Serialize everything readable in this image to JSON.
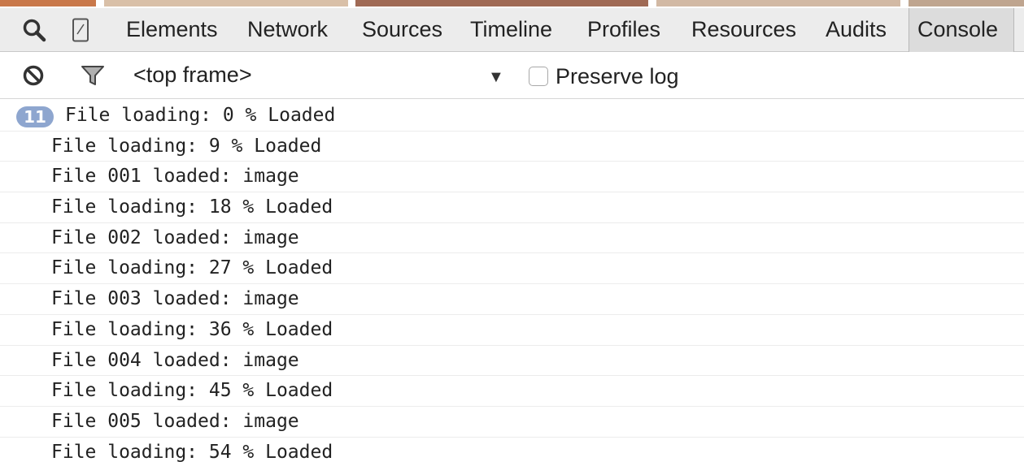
{
  "tabs": [
    {
      "label": "Elements"
    },
    {
      "label": "Network"
    },
    {
      "label": "Sources"
    },
    {
      "label": "Timeline"
    },
    {
      "label": "Profiles"
    },
    {
      "label": "Resources"
    },
    {
      "label": "Audits"
    },
    {
      "label": "Console",
      "active": true
    }
  ],
  "toolbar": {
    "search_icon": "search-icon",
    "device_icon": "mobile-device-icon"
  },
  "console_bar": {
    "clear_icon": "clear-console-icon",
    "filter_icon": "filter-icon",
    "frame_selector": "<top frame>",
    "dropdown_icon": "dropdown-arrow-icon",
    "preserve_log_label": "Preserve log",
    "preserve_log_checked": false
  },
  "messages": [
    {
      "text": "File loading: 0 % Loaded",
      "repeat_count": "11"
    },
    {
      "text": "File loading: 9 % Loaded"
    },
    {
      "text": "File 001 loaded: image"
    },
    {
      "text": "File loading: 18 % Loaded"
    },
    {
      "text": "File 002 loaded: image"
    },
    {
      "text": "File loading: 27 % Loaded"
    },
    {
      "text": "File 003 loaded: image"
    },
    {
      "text": "File loading: 36 % Loaded"
    },
    {
      "text": "File 004 loaded: image"
    },
    {
      "text": "File loading: 45 % Loaded"
    },
    {
      "text": "File 005 loaded: image"
    },
    {
      "text": "File loading: 54 % Loaded"
    }
  ],
  "colors": {
    "badge": "#8ea6cf",
    "toolbar_bg": "#ececec",
    "active_tab_bg": "#dcdcdc"
  }
}
